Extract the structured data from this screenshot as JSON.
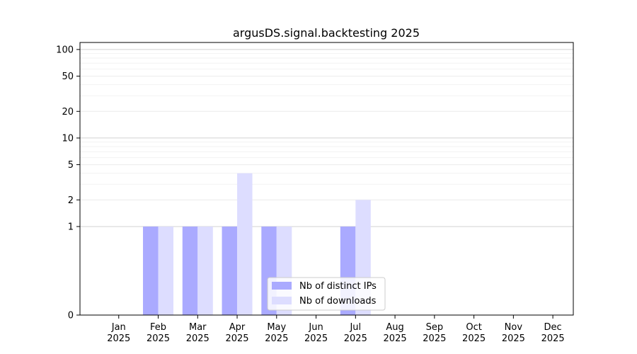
{
  "chart_data": {
    "type": "bar",
    "title": "argusDS.signal.backtesting 2025",
    "xlabel": "",
    "ylabel": "",
    "y_scale": "symlog",
    "ylim": [
      0,
      120
    ],
    "y_ticks": [
      0,
      1,
      2,
      5,
      10,
      20,
      50,
      100
    ],
    "y_tick_labels": [
      "0",
      "1",
      "2",
      "5",
      "10",
      "20",
      "50",
      "100"
    ],
    "grid": true,
    "legend_position": "lower-center",
    "categories": [
      "Jan\n2025",
      "Feb\n2025",
      "Mar\n2025",
      "Apr\n2025",
      "May\n2025",
      "Jun\n2025",
      "Jul\n2025",
      "Aug\n2025",
      "Sep\n2025",
      "Oct\n2025",
      "Nov\n2025",
      "Dec\n2025"
    ],
    "series": [
      {
        "name": "Nb of distinct IPs",
        "color": "#aaaaff",
        "values": [
          0,
          1,
          1,
          1,
          1,
          0,
          1,
          0,
          0,
          0,
          0,
          0
        ]
      },
      {
        "name": "Nb of downloads",
        "color": "#ddddff",
        "values": [
          0,
          1,
          1,
          4,
          1,
          0,
          2,
          0,
          0,
          0,
          0,
          0
        ]
      }
    ]
  }
}
